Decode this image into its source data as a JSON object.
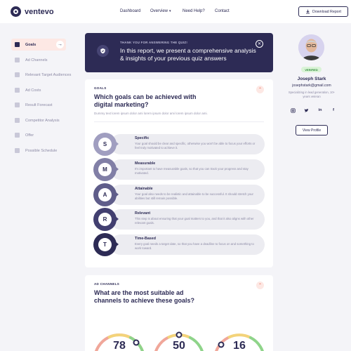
{
  "brand": {
    "name": "ventevo"
  },
  "nav": {
    "items": [
      "Dashboard",
      "Overview",
      "Need Help?",
      "Contact"
    ],
    "download_label": "Download Report"
  },
  "sidebar": {
    "items": [
      {
        "label": "Goals",
        "icon": "target-icon",
        "active": true
      },
      {
        "label": "Ad Channels",
        "icon": "megaphone-icon",
        "active": false
      },
      {
        "label": "Relevant Target Audiences",
        "icon": "users-icon",
        "active": false
      },
      {
        "label": "Ad Costs",
        "icon": "wallet-icon",
        "active": false
      },
      {
        "label": "Result Forecast",
        "icon": "chart-icon",
        "active": false
      },
      {
        "label": "Competitor Analysis",
        "icon": "compare-icon",
        "active": false
      },
      {
        "label": "Offer",
        "icon": "tag-icon",
        "active": false
      },
      {
        "label": "Possible Schedule",
        "icon": "calendar-icon",
        "active": false
      }
    ]
  },
  "banner": {
    "kicker": "THANK YOU FOR ANSWERING THE QUIZ!",
    "title": "In this report, we present a comprehensive analysis & insights of your previous quiz answers"
  },
  "goals": {
    "kicker": "GOALS",
    "title": "Which goals can be achieved with digital marketing?",
    "description": "Dummy text lorem ipsum dolor ami lorem ipsum dolor ami lorem ipsum dolor ami.",
    "smart": [
      {
        "letter": "S",
        "title": "Specific",
        "text": "Your goal should be clear and specific, otherwise you won't be able to focus your efforts or feel truly motivated to achieve it."
      },
      {
        "letter": "M",
        "title": "Measurable",
        "text": "It's important to have measurable goals, so that you can track your progress and stay motivated."
      },
      {
        "letter": "A",
        "title": "Attainable",
        "text": "Your goal also needs to be realistic and attainable to be successful. It should stretch your abilities but still remain possible."
      },
      {
        "letter": "R",
        "title": "Relevant",
        "text": "This step is about ensuring that your goal matters to you, and that it also aligns with other relevant goals."
      },
      {
        "letter": "T",
        "title": "Time-Based",
        "text": "Every goal needs a target date, so that you have a deadline to focus on and something to work toward."
      }
    ]
  },
  "channels": {
    "kicker": "AD CHANNELS",
    "title": "What are the most suitable ad channels to achieve these goals?",
    "gauges": [
      78,
      50,
      16
    ]
  },
  "profile": {
    "badge": "VERIFIED",
    "name": "Joseph Stark",
    "email": "josephstark@gmail.com",
    "bio": "Specializing in lead generation, 10+ years veteran",
    "social": [
      "instagram-icon",
      "twitter-icon",
      "linkedin-icon",
      "facebook-icon"
    ],
    "button": "View Profile"
  },
  "colors": {
    "primary": "#2d2b55",
    "accent": "#e8604a",
    "verified": "#2f8a3a"
  }
}
